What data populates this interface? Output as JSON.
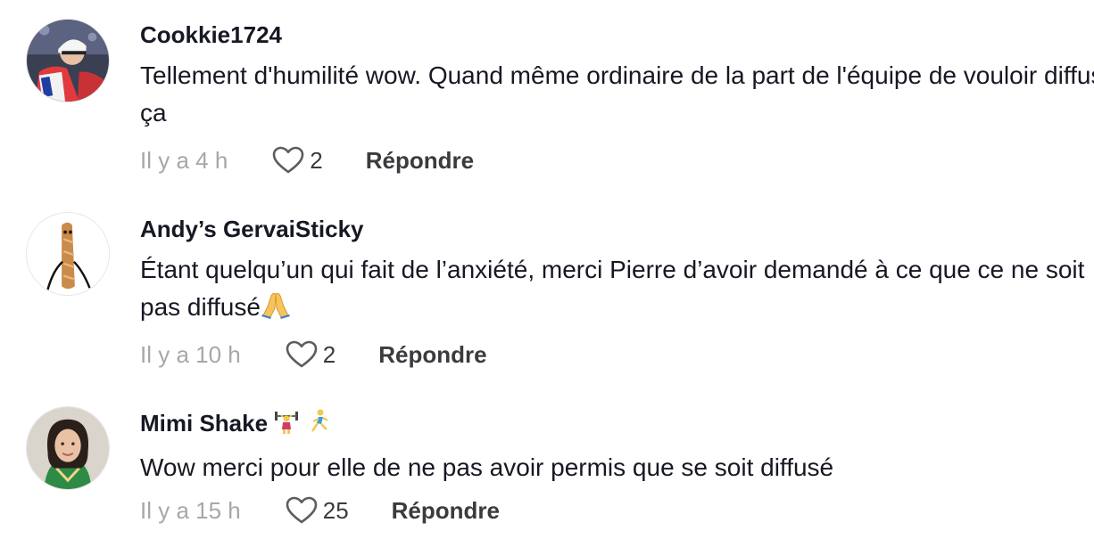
{
  "comments": [
    {
      "username": "Cookkie1724",
      "text": "Tellement d'humilité wow. Quand même ordinaire de la part de l'équipe de vouloir diffuser ça",
      "time": "Il y a 4 h",
      "likes": "2",
      "reply_label": "Répondre",
      "avatar_icon": "hockey-player-avatar"
    },
    {
      "username": "Andy’s GervaiSticky",
      "text": "Étant quelqu’un qui fait de l’anxiété, merci Pierre d’avoir demandé à ce que ce ne soit pas diffusé",
      "text_emoji": "folded-hands",
      "time": "Il y a 10 h",
      "likes": "2",
      "reply_label": "Répondre",
      "avatar_icon": "baguette-character-avatar"
    },
    {
      "username": "Mimi Shake",
      "username_emojis": [
        "weightlifter",
        "runner"
      ],
      "text": "Wow merci pour elle de ne pas avoir permis que se soit diffusé",
      "time": "Il y a 15 h",
      "likes": "25",
      "reply_label": "Répondre",
      "avatar_icon": "woman-portrait-avatar"
    }
  ],
  "colors": {
    "text": "#161823",
    "muted": "#a7a7ab",
    "action": "#3b3b3f"
  }
}
